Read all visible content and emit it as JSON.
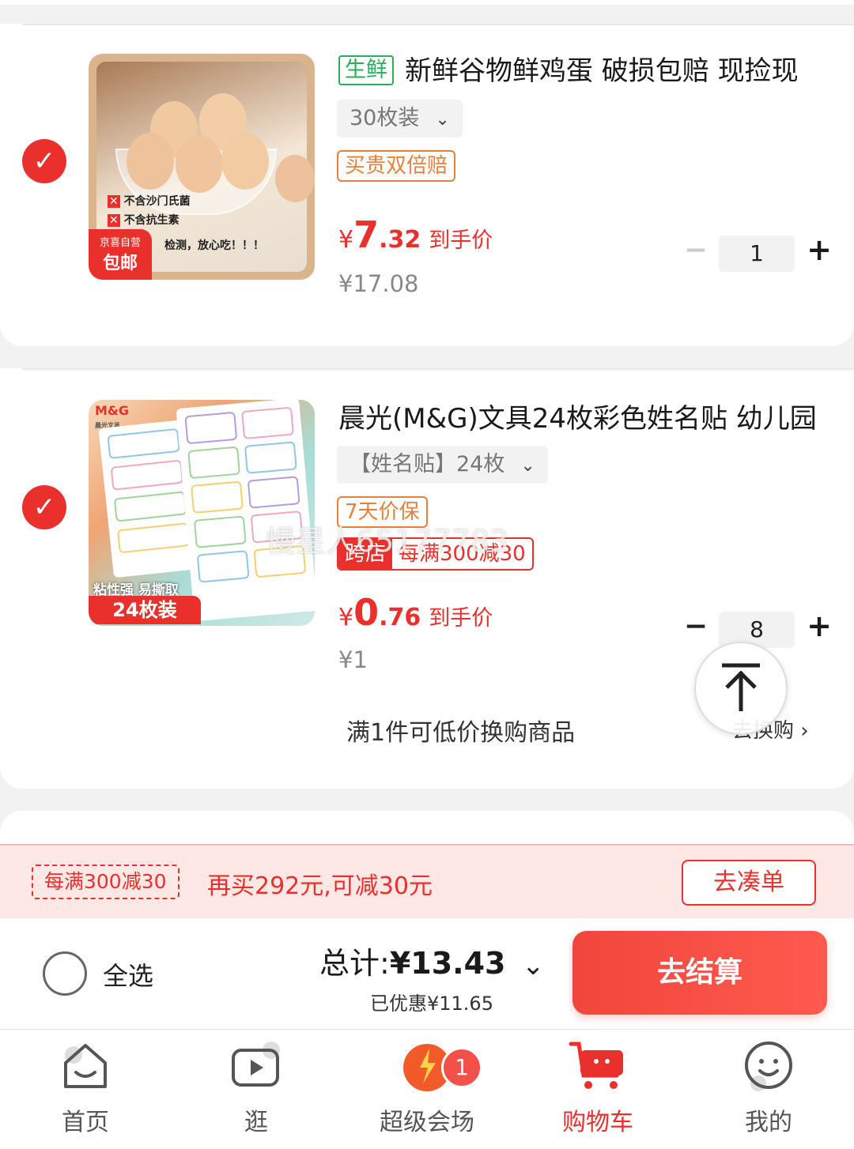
{
  "items": [
    {
      "tag": "生鲜",
      "title": "新鲜谷物鲜鸡蛋 破损包赔 现捡现",
      "spec": "30枚装",
      "badge": "买贵双倍赔",
      "price_symbol": "¥",
      "price_int": "7",
      "price_dec": ".32",
      "price_label": "到手价",
      "orig_price": "¥17.08",
      "quantity": "1",
      "image": {
        "overlay_line1": "不含沙门氏菌",
        "overlay_line2": "不含抗生素",
        "overlay_line3": "检测，放心吃！！！",
        "corner_top": "京喜自营",
        "corner_bottom": "包邮"
      }
    },
    {
      "title": "晨光(M&G)文具24枚彩色姓名贴 幼儿园",
      "spec": "【姓名贴】24枚",
      "badge": "7天价保",
      "cross_store_tag": "跨店",
      "cross_store_text": "每满300减30",
      "price_symbol": "¥",
      "price_int": "0",
      "price_dec": ".76",
      "price_label": "到手价",
      "orig_price": "¥1",
      "quantity": "8",
      "exchange_text": "满1件可低价换购商品",
      "exchange_link": "去换购",
      "image": {
        "brand": "M&G",
        "brand_sub": "晨光文具",
        "caption1": "粘性强 易撕取",
        "caption2": "24枚装"
      }
    }
  ],
  "watermark": "慢星人65177783",
  "promo": {
    "coupon": "每满300减30",
    "message": "再买292元,可减30元",
    "button": "去凑单"
  },
  "checkout": {
    "select_all": "全选",
    "total_label": "总计:",
    "total_value": "¥13.43",
    "discount": "已优惠¥11.65",
    "button": "去结算"
  },
  "nav": {
    "items": [
      {
        "label": "首页",
        "icon": "home-icon"
      },
      {
        "label": "逛",
        "icon": "video-play-icon"
      },
      {
        "label": "超级会场",
        "icon": "save-badge-icon",
        "badge": "1"
      },
      {
        "label": "购物车",
        "icon": "cart-icon",
        "active": true
      },
      {
        "label": "我的",
        "icon": "smiley-icon"
      }
    ]
  },
  "colors": {
    "accent": "#e9302c",
    "fresh_green": "#2bae5a",
    "badge_orange": "#e8803a"
  }
}
